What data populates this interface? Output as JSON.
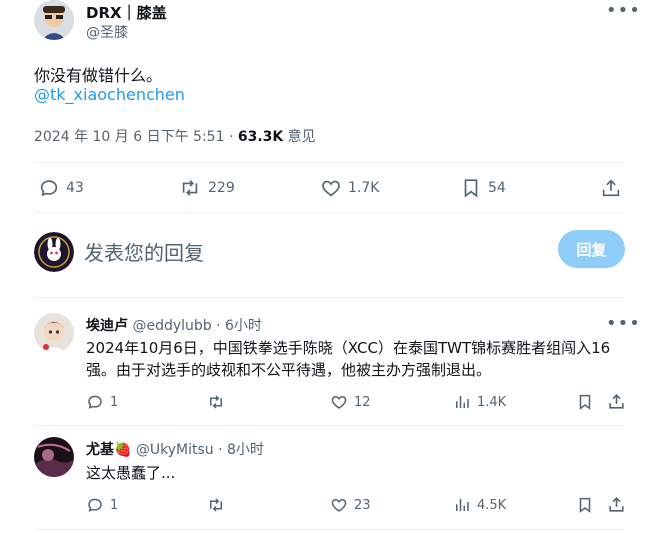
{
  "main_tweet": {
    "display_name": "DRX｜膝盖",
    "handle": "@圣膝",
    "text": "你没有做错什么。",
    "mention": "@tk_xiaochenchen",
    "timestamp": "2024 年 10 月 6 日下午 5:51 · ",
    "views_count": "63.3K",
    "views_label": " 意见",
    "stats": {
      "replies": "43",
      "retweets": "229",
      "likes": "1.7K",
      "bookmarks": "54"
    }
  },
  "compose": {
    "placeholder": "发表您的回复",
    "reply_button": "回复"
  },
  "replies": [
    {
      "display_name": "埃迪卢",
      "handle": "@eddylubb",
      "time": " · 6小时",
      "text_line1": "2024年10月6日，中国铁拳选手陈晓（XCC）在泰国TWT锦标赛胜者组闯入16",
      "text_line2": "强。由于对选手的歧视和不公平待遇，他被主办方强制退出。",
      "stats": {
        "replies": "1",
        "retweets": "",
        "likes": "12",
        "views": "1.4K"
      }
    },
    {
      "display_name": "尤基🍓",
      "handle": "@UkyMitsu",
      "time": " · 8小时",
      "text_line1": "这太愚蠢了...",
      "stats": {
        "replies": "1",
        "retweets": "",
        "likes": "23",
        "views": "4.5K"
      }
    }
  ],
  "colors": {
    "accent": "#1d9bf0",
    "reply_button_disabled": "#8ecdf8",
    "text_muted": "#536471"
  }
}
